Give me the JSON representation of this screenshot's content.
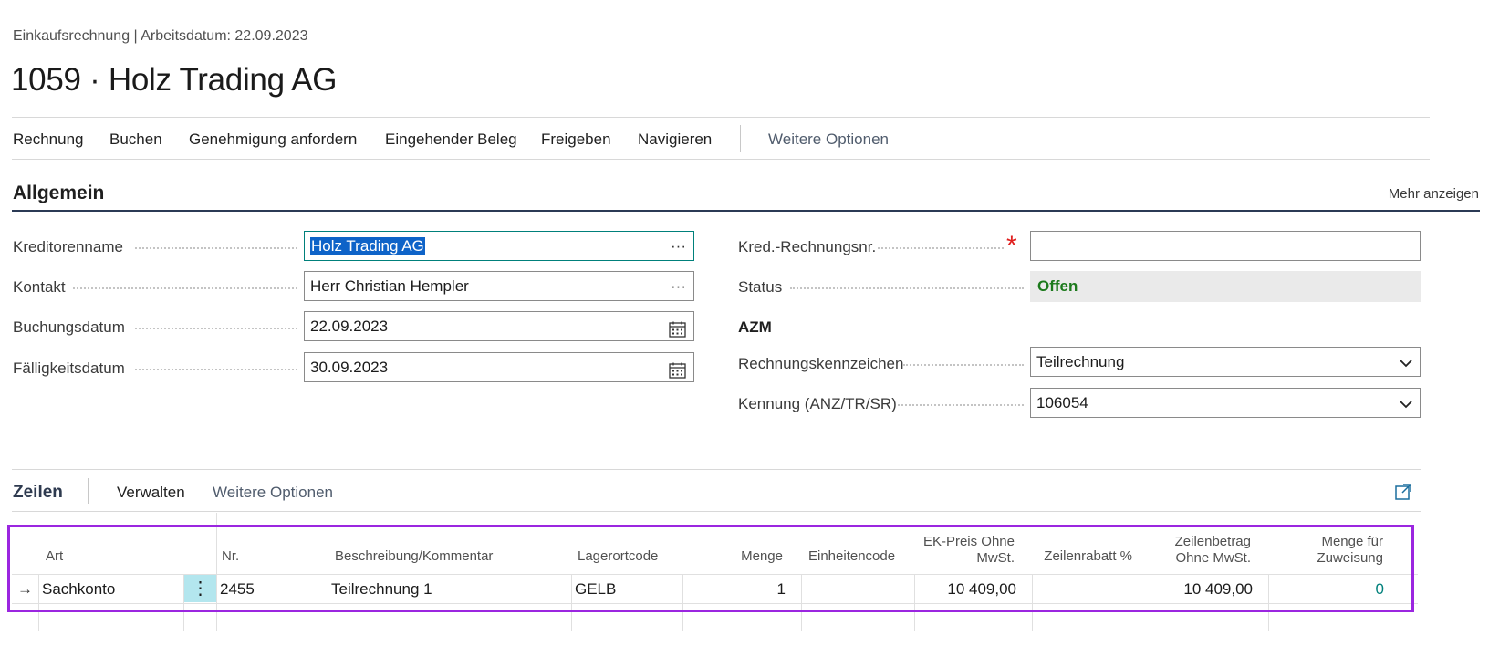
{
  "header": {
    "caption": "Einkaufsrechnung | Arbeitsdatum: 22.09.2023",
    "title": "1059 · Holz Trading AG"
  },
  "actions": [
    "Rechnung",
    "Buchen",
    "Genehmigung anfordern",
    "Eingehender Beleg",
    "Freigeben",
    "Navigieren",
    "Weitere Optionen"
  ],
  "general": {
    "title": "Allgemein",
    "more_label": "Mehr anzeigen",
    "vendor_name": {
      "label": "Kreditorenname",
      "value": "Holz Trading AG",
      "trail": "···"
    },
    "contact": {
      "label": "Kontakt",
      "value": "Herr Christian Hempler",
      "trail": "···"
    },
    "posting_date": {
      "label": "Buchungsdatum",
      "value": "22.09.2023"
    },
    "due_date": {
      "label": "Fälligkeitsdatum",
      "value": "30.09.2023"
    },
    "vendor_invoice_no": {
      "label": "Kred.-Rechnungsnr.",
      "value": "",
      "required_mark": "*"
    },
    "status": {
      "label": "Status",
      "value": "Offen",
      "color": "#1c7a1c"
    },
    "azm": {
      "title": "AZM",
      "invoice_flag": {
        "label": "Rechnungskennzeichen",
        "value": "Teilrechnung"
      },
      "identifier": {
        "label": "Kennung (ANZ/TR/SR)",
        "value": "106054"
      }
    }
  },
  "lines": {
    "title": "Zeilen",
    "actions": [
      "Verwalten",
      "Weitere Optionen"
    ],
    "columns": {
      "art": "Art",
      "nr": "Nr.",
      "desc": "Beschreibung/Kommentar",
      "loc": "Lagerortcode",
      "qty": "Menge",
      "unit": "Einheitencode",
      "price_1": "EK-Preis Ohne",
      "price_2": "MwSt.",
      "disc": "Zeilenrabatt %",
      "amount_1": "Zeilenbetrag",
      "amount_2": "Ohne MwSt.",
      "assign_1": "Menge für",
      "assign_2": "Zuweisung"
    },
    "row": {
      "indicator": "→",
      "art": "Sachkonto",
      "nr": "2455",
      "desc": "Teilrechnung 1",
      "loc": "GELB",
      "qty": "1",
      "unit": "",
      "price": "10 409,00",
      "disc": "",
      "amount": "10 409,00",
      "assign": "0"
    }
  },
  "colors": {
    "accent": "#00807b",
    "selection": "#0e63c8",
    "highlight": "#9b26e0"
  }
}
